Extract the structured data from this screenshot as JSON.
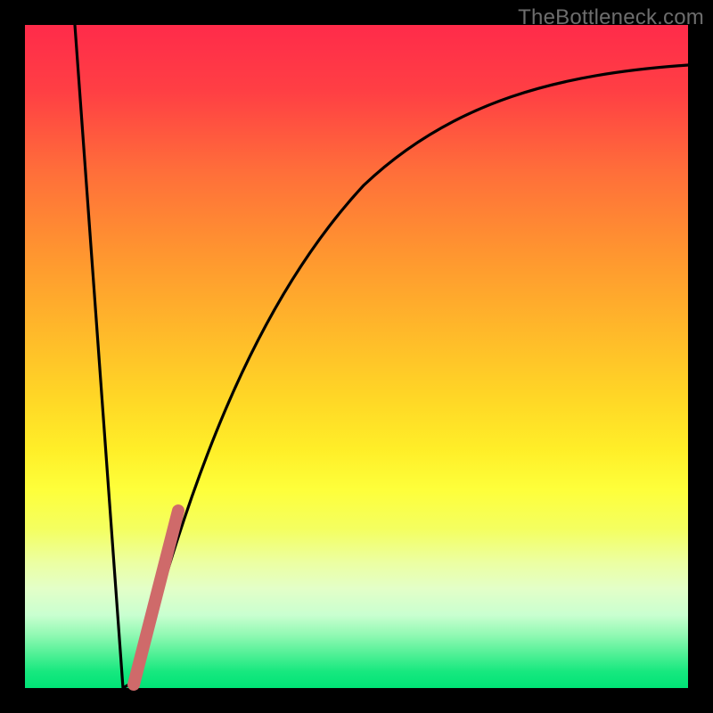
{
  "watermark": "TheBottleneck.com",
  "colors": {
    "frame": "#000000",
    "curve_stroke": "#000000",
    "pink_stroke": "#cf6a6a"
  },
  "chart_data": {
    "type": "line",
    "title": "",
    "xlabel": "",
    "ylabel": "",
    "xlim": [
      0,
      100
    ],
    "ylim": [
      0,
      100
    ],
    "series": [
      {
        "name": "bottleneck-curve",
        "x": [
          0,
          6,
          10,
          12,
          14,
          16,
          20,
          25,
          30,
          35,
          40,
          50,
          60,
          70,
          80,
          90,
          100
        ],
        "y": [
          100,
          40,
          10,
          2,
          1,
          5,
          20,
          40,
          55,
          65,
          72,
          80,
          85,
          88,
          90,
          91,
          92
        ]
      }
    ],
    "highlight_segment": {
      "name": "pink-segment",
      "x": [
        14,
        16,
        18,
        20,
        22
      ],
      "y": [
        1,
        7,
        15,
        22,
        30
      ]
    },
    "gradient_stops": [
      {
        "pct": 0,
        "color": "#ff2b4a"
      },
      {
        "pct": 50,
        "color": "#ffe028"
      },
      {
        "pct": 100,
        "color": "#00e376"
      }
    ]
  }
}
